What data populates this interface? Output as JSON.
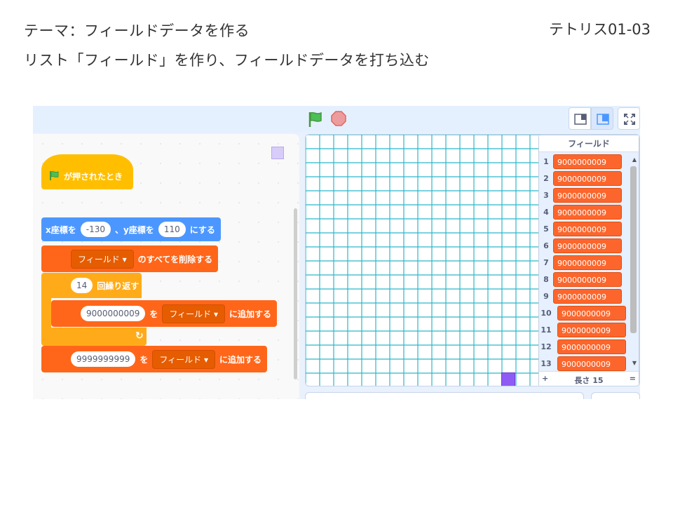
{
  "slide": {
    "title": "テーマ：フィールドデータを作る",
    "subtitle": "リスト「フィールド」を作り、フィールドデータを打ち込む",
    "code": "テトリス01-03"
  },
  "toolbar": {
    "green_flag_icon": "green-flag",
    "stop_icon": "stop-sign",
    "small_stage_icon": "small-stage-layout",
    "large_stage_icon": "large-stage-layout",
    "fullscreen_icon": "fullscreen"
  },
  "colors": {
    "event": "#ffbf00",
    "motion": "#4c97ff",
    "control": "#ffab19",
    "list": "#ff661a",
    "grid_line": "#2bb7c9",
    "sprite": "#8f5bf5"
  },
  "script": {
    "hat": {
      "label": "が押されたとき"
    },
    "goto": {
      "x_label": "x座標を",
      "x_value": "-130",
      "mid": "、y座標を",
      "y_value": "110",
      "end": "にする"
    },
    "delete_all": {
      "list": "フィールド",
      "label": "のすべてを削除する"
    },
    "repeat": {
      "count": "14",
      "label": "回繰り返す"
    },
    "add_inner": {
      "value": "9000000009",
      "wo": "を",
      "list": "フィールド",
      "label": "に追加する"
    },
    "add_after": {
      "value": "9999999999",
      "wo": "を",
      "list": "フィールド",
      "label": "に追加する"
    }
  },
  "list_monitor": {
    "title": "フィールド",
    "items": [
      {
        "index": "1",
        "value": "9000000009"
      },
      {
        "index": "2",
        "value": "9000000009"
      },
      {
        "index": "3",
        "value": "9000000009"
      },
      {
        "index": "4",
        "value": "9000000009"
      },
      {
        "index": "5",
        "value": "9000000009"
      },
      {
        "index": "6",
        "value": "9000000009"
      },
      {
        "index": "7",
        "value": "9000000009"
      },
      {
        "index": "8",
        "value": "9000000009"
      },
      {
        "index": "9",
        "value": "9000000009"
      },
      {
        "index": "10",
        "value": "9000000009"
      },
      {
        "index": "11",
        "value": "9000000009"
      },
      {
        "index": "12",
        "value": "9000000009"
      },
      {
        "index": "13",
        "value": "9000000009"
      }
    ],
    "add_symbol": "+",
    "length_label": "長さ 15",
    "resize_symbol": "="
  }
}
